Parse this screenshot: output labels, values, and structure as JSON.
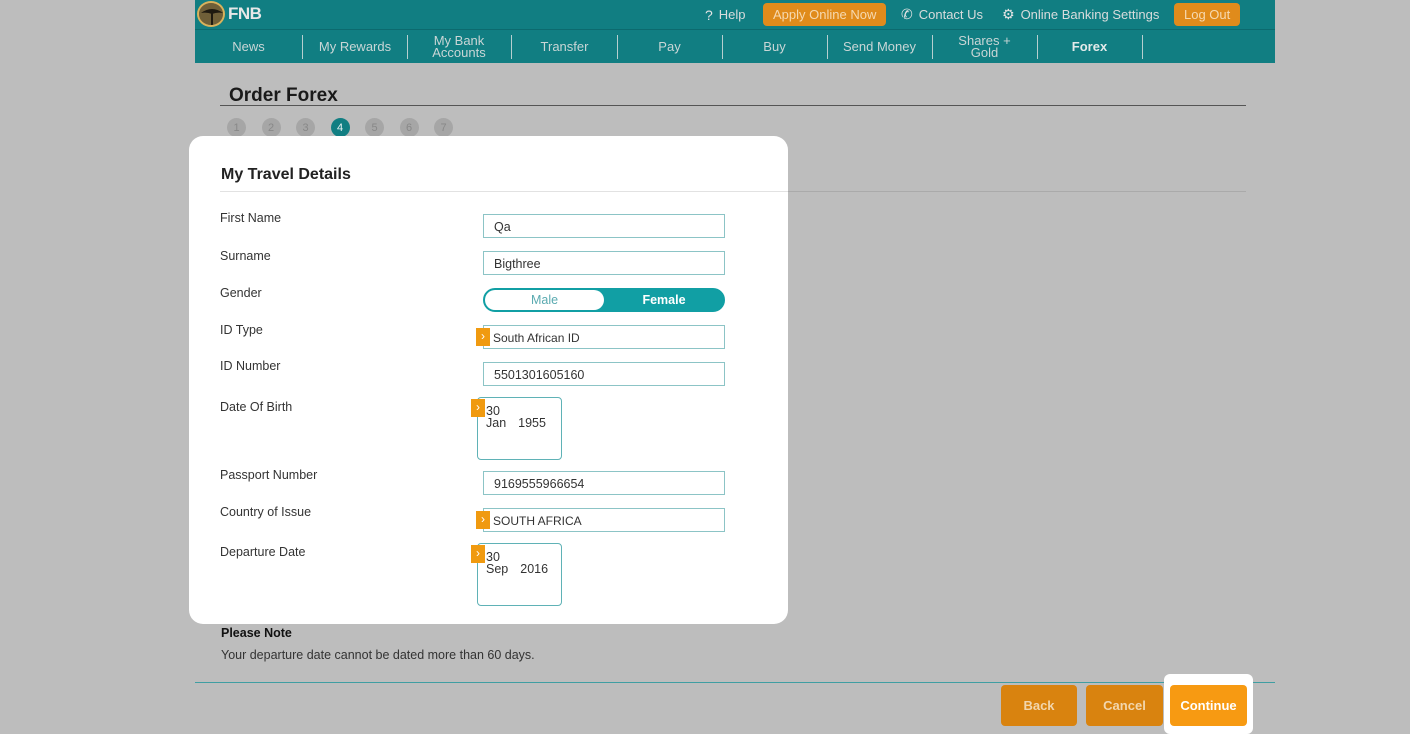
{
  "header": {
    "logo_text": "FNB",
    "help": "Help",
    "apply_online": "Apply Online Now",
    "contact_us": "Contact Us",
    "online_banking_settings": "Online Banking Settings",
    "log_out": "Log Out"
  },
  "nav": {
    "news": "News",
    "my_rewards": "My Rewards",
    "my_bank_accounts_line1": "My Bank",
    "my_bank_accounts_line2": "Accounts",
    "transfer": "Transfer",
    "pay": "Pay",
    "buy": "Buy",
    "send_money": "Send Money",
    "shares_gold_line1": "Shares +",
    "shares_gold_line2": "Gold",
    "forex": "Forex"
  },
  "page": {
    "title": "Order Forex",
    "steps": [
      "1",
      "2",
      "3",
      "4",
      "5",
      "6",
      "7"
    ],
    "active_step": 4
  },
  "form": {
    "title": "My Travel Details",
    "first_name_label": "First Name",
    "first_name_value": "Qa",
    "surname_label": "Surname",
    "surname_value": "Bigthree",
    "gender_label": "Gender",
    "gender_male": "Male",
    "gender_female": "Female",
    "gender_selected": "Female",
    "id_type_label": "ID Type",
    "id_type_value": "South African ID",
    "id_number_label": "ID Number",
    "id_number_value": "5501301605160",
    "dob_label": "Date Of Birth",
    "dob_day": "30",
    "dob_month": "Jan",
    "dob_year": "1955",
    "passport_label": "Passport Number",
    "passport_value": "9169555966654",
    "country_label": "Country of Issue",
    "country_value": "SOUTH AFRICA",
    "departure_label": "Departure Date",
    "departure_day": "30",
    "departure_month": "Sep",
    "departure_year": "2016"
  },
  "note": {
    "title": "Please Note",
    "text": "Your departure date cannot be dated more than 60 days."
  },
  "buttons": {
    "back": "Back",
    "cancel": "Cancel",
    "continue": "Continue"
  },
  "colors": {
    "brand_teal": "#117e82",
    "accent_orange": "#f79a12",
    "toggle_teal": "#119fa4"
  }
}
